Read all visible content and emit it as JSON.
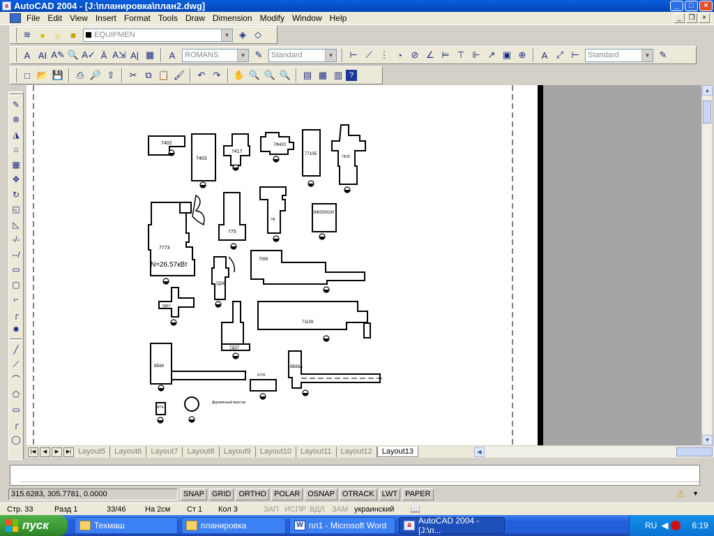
{
  "window": {
    "title": "AutoCAD 2004 - [J:\\планировка\\план2.dwg]"
  },
  "menu": [
    "File",
    "Edit",
    "View",
    "Insert",
    "Format",
    "Tools",
    "Draw",
    "Dimension",
    "Modify",
    "Window",
    "Help"
  ],
  "toolbars": {
    "layer_combo": "EQUIPMEN",
    "text_style_combo": "ROMANS",
    "text_std_combo": "Standard",
    "dim_style_combo": "Standard"
  },
  "drawing": {
    "labels": [
      "7402",
      "7403",
      "7417",
      "7Ф420",
      "7710Б",
      "7Ф25",
      "7773",
      "N=26.57кВт",
      "775",
      "7Ф",
      "8Ф25002И",
      "7Д36",
      "7558",
      "7ДФ7",
      "7Д37",
      "71109",
      "8Б68",
      "6Т25",
      "8Б66А",
      "ФТ4",
      "Деревянный верстак"
    ]
  },
  "layout_tabs": [
    "Layout5",
    "Layout6",
    "Layout7",
    "Layout8",
    "Layout9",
    "Layout10",
    "Layout11",
    "Layout12",
    "Layout13"
  ],
  "active_tab": "Layout13",
  "status": {
    "coords": "315.6283, 305.7781, 0.0000",
    "toggles": [
      "SNAP",
      "GRID",
      "ORTHO",
      "POLAR",
      "OSNAP",
      "OTRACK",
      "LWT",
      "PAPER"
    ]
  },
  "word_status": {
    "page": "Стр. 33",
    "section": "Разд 1",
    "pages": "33/46",
    "position": "На 2см",
    "line": "Ст 1",
    "column": "Кол 3",
    "rec": "ЗАП",
    "trk": "ИСПР",
    "ext": "ВДЛ",
    "ovr": "ЗАМ",
    "language": "украинский"
  },
  "taskbar": {
    "start": "пуск",
    "tasks": [
      "Техмаш",
      "планировка",
      "пл1 - Microsoft Word",
      "AutoCAD 2004 - [J:\\п..."
    ],
    "active_task": 3,
    "lang": "RU",
    "time": "6:19"
  },
  "colors": {
    "titlebar": "#0a5fdc",
    "taskbar": "#245edb",
    "start": "#3a9a34",
    "paper": "#ffffff",
    "background": "#a5a5a5"
  }
}
